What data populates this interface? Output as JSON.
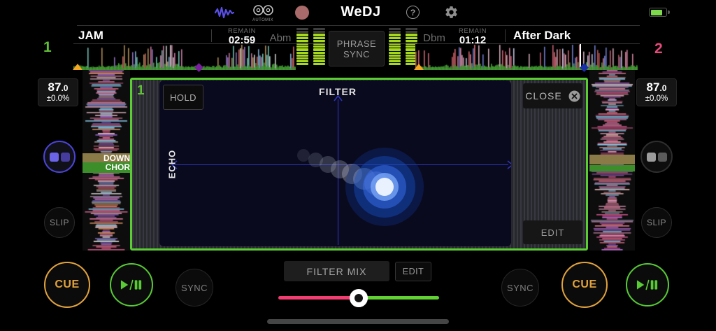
{
  "top_bar": {
    "title": "WeDJ",
    "automix_label": "AUTOMIX",
    "battery_level_frac": 0.78
  },
  "deck1": {
    "number": "1",
    "title": "JAM",
    "remain_label": "REMAIN",
    "remain_time": "02:59",
    "key": "Abm",
    "bpm_main": "87",
    "bpm_decimal": ".0",
    "tempo_range": "±0.0%",
    "slip_label": "SLIP",
    "cue_label": "CUE",
    "sync_label": "SYNC",
    "phrase_labels": {
      "first": "DOWN",
      "second": "CHOR"
    },
    "meter": {
      "segments": 13,
      "lit": 11
    }
  },
  "deck2": {
    "number": "2",
    "title": "After Dark",
    "remain_label": "REMAIN",
    "remain_time": "01:12",
    "key": "Dbm",
    "bpm_main": "87",
    "bpm_decimal": ".0",
    "tempo_range": "±0.0%",
    "slip_label": "SLIP",
    "cue_label": "CUE",
    "sync_label": "SYNC",
    "meter": {
      "segments": 13,
      "lit": 11
    }
  },
  "center": {
    "phrase_sync_line1": "PHRASE",
    "phrase_sync_line2": "SYNC",
    "filter_mix_label": "FILTER MIX",
    "edit_label": "EDIT",
    "crossfader_frac": 0.5
  },
  "fx_panel": {
    "deck_number": "1",
    "hold_label": "HOLD",
    "x_axis_label": "FILTER",
    "y_axis_label": "ECHO",
    "close_label": "CLOSE",
    "edit_label": "EDIT",
    "touch": {
      "x_frac": 0.64,
      "y_frac": 0.64
    },
    "trail_start": {
      "x_frac": 0.41,
      "y_frac": 0.45
    }
  },
  "colors": {
    "panel_green": "#5bcc33",
    "deck1_accent": "#5fbf37",
    "deck2_accent": "#e84a7c",
    "cue_orange": "#e2a33c",
    "play_green": "#58cb35",
    "pad_purple": "#4b43d8",
    "axis_blue": "#2f36c2",
    "meter_green": "#a6d81f",
    "fader_pink": "#f23c72",
    "fader_green": "#5fd232",
    "record_red": "#a96a6b"
  }
}
